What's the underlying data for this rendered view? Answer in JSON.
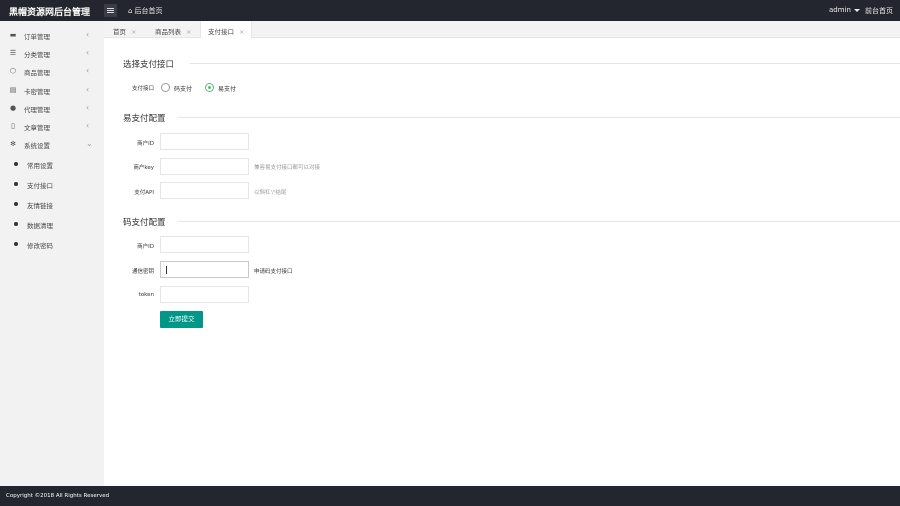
{
  "header": {
    "logo": "黑帽资源网后台管理",
    "home_link": "后台首页",
    "user": "admin",
    "front_link": "前台首页"
  },
  "sidebar": {
    "items": [
      {
        "label": "订单管理",
        "icon": "card-icon"
      },
      {
        "label": "分类管理",
        "icon": "list-icon"
      },
      {
        "label": "商品管理",
        "icon": "box-icon"
      },
      {
        "label": "卡密管理",
        "icon": "key-icon"
      },
      {
        "label": "代理管理",
        "icon": "users-icon"
      },
      {
        "label": "文章管理",
        "icon": "document-icon"
      },
      {
        "label": "系统设置",
        "icon": "settings-icon"
      }
    ],
    "sub_items": [
      {
        "label": "常用设置"
      },
      {
        "label": "支付接口"
      },
      {
        "label": "友情链接"
      },
      {
        "label": "数据清理"
      },
      {
        "label": "修改密码"
      }
    ]
  },
  "tabs": [
    {
      "label": "首页",
      "close": "×"
    },
    {
      "label": "商品列表",
      "close": "×"
    },
    {
      "label": "支付接口",
      "close": "×"
    }
  ],
  "main": {
    "section1": {
      "title": "选择支付接口",
      "field_label": "支付接口",
      "options": [
        "码支付",
        "易支付"
      ],
      "selected": "易支付"
    },
    "section2": {
      "title": "易支付配置",
      "fields": [
        {
          "label": "商户ID",
          "value": "",
          "hint": ""
        },
        {
          "label": "商户key",
          "value": "",
          "hint": "兼容易支付接口都可以对接"
        },
        {
          "label": "支付API",
          "value": "",
          "hint": "以斜杠'/'结尾"
        }
      ]
    },
    "section3": {
      "title": "码支付配置",
      "fields": [
        {
          "label": "商户ID",
          "value": "",
          "hint": ""
        },
        {
          "label": "通信密钥",
          "value": "",
          "hint": "申请码支付接口"
        },
        {
          "label": "token",
          "value": "",
          "hint": ""
        }
      ]
    },
    "submit_label": "立即提交"
  },
  "footer": {
    "copyright": "Copyright ©2018 All Rights Reserved"
  },
  "colors": {
    "topbar": "#23262e",
    "accent": "#009688",
    "radio_checked": "#5fb878"
  }
}
